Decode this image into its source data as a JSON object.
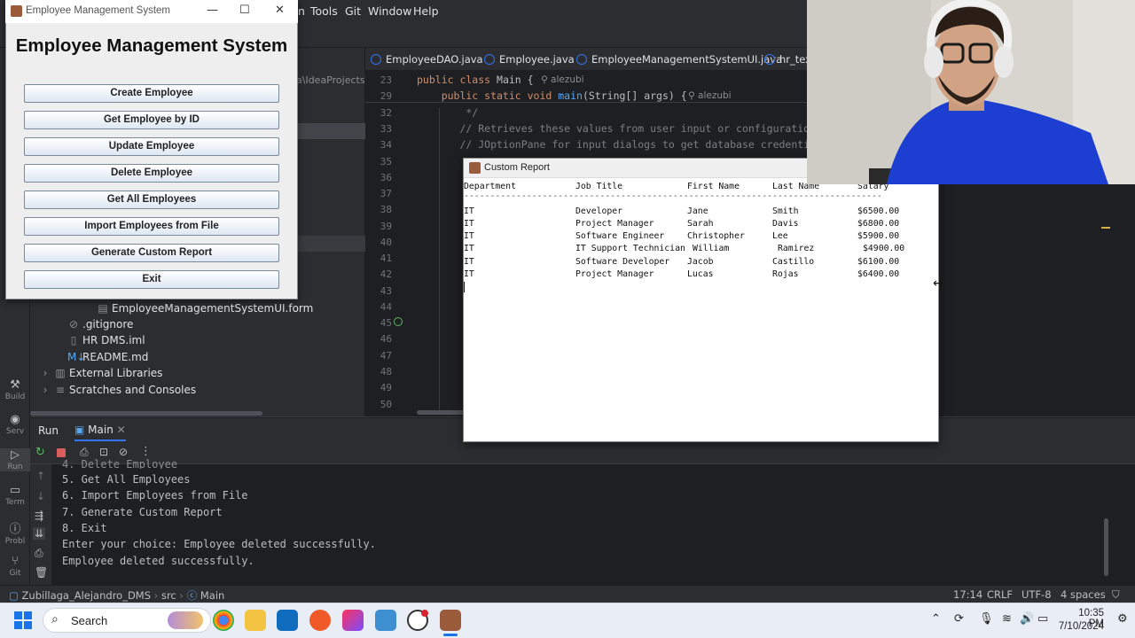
{
  "ide": {
    "menu": [
      "n",
      "Tools",
      "Git",
      "Window",
      "Help"
    ],
    "editor_tabs": [
      "EmployeeDAO.java",
      "Employee.java",
      "EmployeeManagementSystemUI.java",
      "hr_tex"
    ],
    "path_fragment": "a\\IdeaProjects\\",
    "project_tree": [
      {
        "label": "EmployeeManagementSystemUI.form",
        "icon": "form-icon"
      },
      {
        "label": ".gitignore",
        "icon": "ignore-icon"
      },
      {
        "label": "HR DMS.iml",
        "icon": "file-icon"
      },
      {
        "label": "README.md",
        "icon": "markdown-icon"
      },
      {
        "label": "External Libraries",
        "icon": "library-icon"
      },
      {
        "label": "Scratches and Consoles",
        "icon": "scratch-icon"
      }
    ],
    "code": {
      "line_numbers": [
        "23",
        "29",
        "32",
        "33",
        "34",
        "35",
        "36",
        "37",
        "38",
        "39",
        "40",
        "41",
        "42",
        "43",
        "44",
        "45",
        "46",
        "47",
        "48",
        "49",
        "50"
      ],
      "line_23_a": "public class ",
      "line_23_b": "Main {",
      "author": "alezubi",
      "line_29_a": "    public static void ",
      "line_29_b": "main",
      "line_29_c": "(String[] args) {",
      "line_32": "        */",
      "line_33": "       // Retrieves these values from user input or configuration",
      "line_34": "       // JOptionPane for input dialogs to get database credentia"
    },
    "left_stripe": [
      "Build",
      "Serv",
      "Run",
      "Term",
      "Probl",
      "Git"
    ],
    "run": {
      "tab_run": "Run",
      "tab_main": "Main",
      "console": [
        "4. Delete Employee",
        "5. Get All Employees",
        "6. Import Employees from File",
        "7. Generate Custom Report",
        "8. Exit",
        "Enter your choice: Employee deleted successfully.",
        "Employee deleted successfully."
      ]
    },
    "status": {
      "breadcrumb": [
        "Zubillaga_Alejandro_DMS",
        "src",
        "Main"
      ],
      "position": "17:14",
      "line_sep": "CRLF",
      "encoding": "UTF-8",
      "indent": "4 spaces"
    }
  },
  "ems_window": {
    "title": "Employee Management System",
    "heading": "Employee Management System",
    "buttons": [
      "Create Employee",
      "Get Employee by ID",
      "Update Employee",
      "Delete Employee",
      "Get All Employees",
      "Import Employees from File",
      "Generate Custom Report",
      "Exit"
    ]
  },
  "report_window": {
    "title": "Custom Report",
    "columns": [
      "Department",
      "Job Title",
      "First Name",
      "Last Name",
      "Salary"
    ],
    "separator": "--------------------------------------------------------------------------------",
    "rows": [
      [
        "IT",
        "Developer",
        "Jane",
        "Smith",
        "$6500.00"
      ],
      [
        "IT",
        "Project Manager",
        "Sarah",
        "Davis",
        "$6800.00"
      ],
      [
        "IT",
        "Software Engineer",
        "Christopher",
        "Lee",
        "$5900.00"
      ],
      [
        "IT",
        "IT Support Technician",
        "William",
        "Ramirez",
        "$4900.00"
      ],
      [
        "IT",
        "Software Developer",
        "Jacob",
        "Castillo",
        "$6100.00"
      ],
      [
        "IT",
        "Project Manager",
        "Lucas",
        "Rojas",
        "$6400.00"
      ]
    ]
  },
  "taskbar": {
    "search_placeholder": "Search",
    "time": "10:35 PM",
    "date": "7/10/2024"
  },
  "colors": {
    "ide_bg": "#1e1f22",
    "ide_panel": "#2b2d30",
    "accent": "#3574f0",
    "taskbar": "#e9eef6"
  }
}
